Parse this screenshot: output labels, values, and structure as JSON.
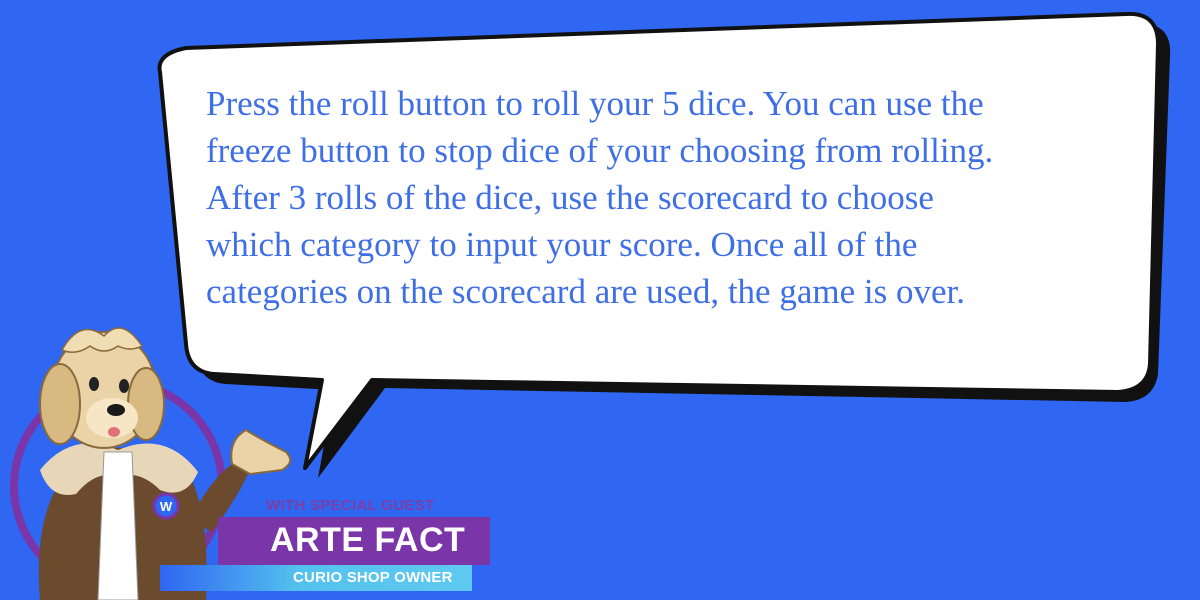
{
  "instructions": {
    "lines": [
      "Press the roll button to roll your 5 dice. You can use the",
      "freeze button to stop dice of your choosing from rolling.",
      "After 3 rolls of the dice, use the scorecard to choose",
      "which category to input your score. Once all of the",
      "categories on the scorecard are used, the game is over."
    ]
  },
  "guest": {
    "intro": "WITH SPECIAL GUEST",
    "name": "ARTE FACT",
    "role": "CURIO SHOP OWNER",
    "badge_letter": "W"
  },
  "colors": {
    "background": "#2f66f2",
    "text": "#3f6fe6",
    "purple": "#7a35a8",
    "cyan": "#5ec9f0"
  }
}
